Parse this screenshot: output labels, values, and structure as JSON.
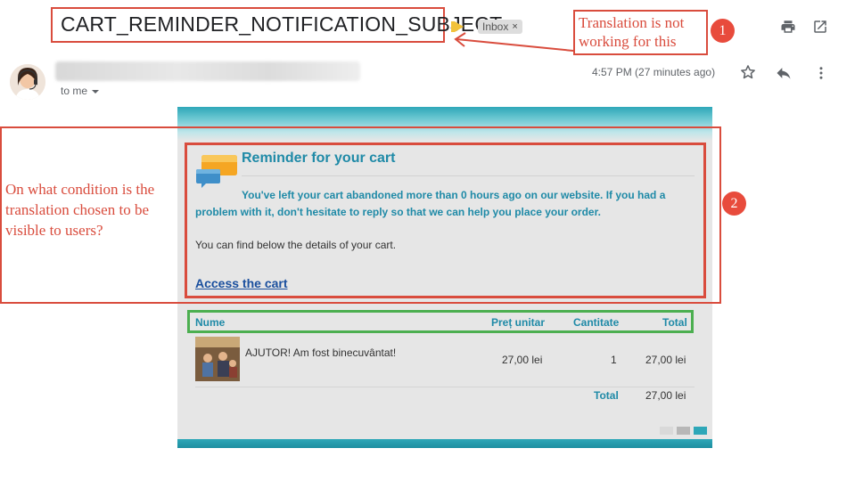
{
  "email": {
    "subject": "CART_REMINDER_NOTIFICATION_SUBJECT",
    "label": "Inbox",
    "label_remove": "×",
    "recipient": "to me",
    "timestamp": "4:57 PM (27 minutes ago)"
  },
  "annotations": {
    "note_1": "Translation is not working for this",
    "note_2": "On what condition is the translation chosen to be  visible to users?",
    "badge_1": "1",
    "badge_2": "2"
  },
  "message": {
    "title": "Reminder for your cart",
    "body": "You've left your cart abandoned more than 0 hours ago on our website. If you had a problem with it, don't hesitate to reply so that we can help you place your order.",
    "details": "You can find below the details of your cart.",
    "link": "Access the cart"
  },
  "cart_table": {
    "headers": [
      "Nume",
      "Preț unitar",
      "Cantitate",
      "Total"
    ],
    "rows": [
      {
        "name": "AJUTOR! Am fost binecuvântat!",
        "price": "27,00 lei",
        "quantity": "1",
        "total": "27,00 lei"
      }
    ],
    "total_label": "Total",
    "total_value": "27,00 lei"
  },
  "icons": {
    "print": "print-icon",
    "popout": "open-in-new-window-icon",
    "star": "star-icon",
    "reply": "reply-icon",
    "more": "more-vertical-icon",
    "chat": "chat-bubbles-icon"
  },
  "colors": {
    "annotation_red": "#d94c3d",
    "badge_red": "#e84b3c",
    "table_green": "#4caf50",
    "teal_accent": "#1f8aa7",
    "link_blue": "#1a4f9e"
  }
}
